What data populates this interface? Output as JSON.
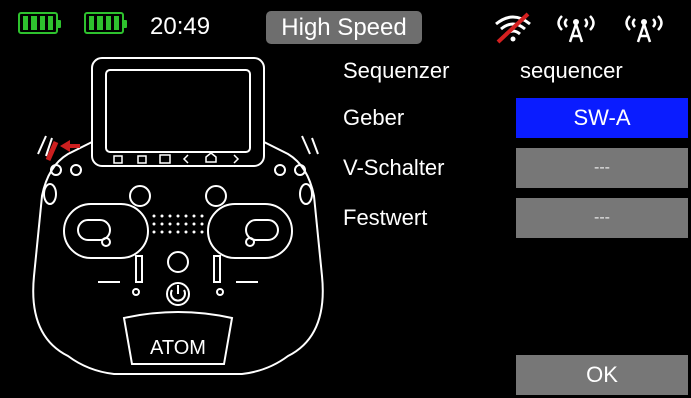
{
  "status": {
    "batteries": [
      "tx-battery",
      "rx-battery"
    ],
    "time": "20:49",
    "mode": "High Speed",
    "icons": [
      "wifi-off-icon",
      "antenna-icon",
      "antenna-icon"
    ],
    "colors": {
      "battery": "#2ec22e",
      "wifi_off_slash": "#d42020",
      "mode_badge": "#6e6e6e"
    }
  },
  "form": {
    "rows": [
      {
        "label": "Sequenzer",
        "value": "sequencer"
      },
      {
        "label": "Geber",
        "value": "SW-A"
      },
      {
        "label": "V-Schalter",
        "value": "---"
      },
      {
        "label": "Festwert",
        "value": "---"
      }
    ],
    "ok_label": "OK",
    "colors": {
      "selected": "#0a1cff",
      "button": "#777777"
    }
  },
  "transmitter": {
    "brand": "ATOM",
    "highlight_color": "#cc1f1f"
  }
}
